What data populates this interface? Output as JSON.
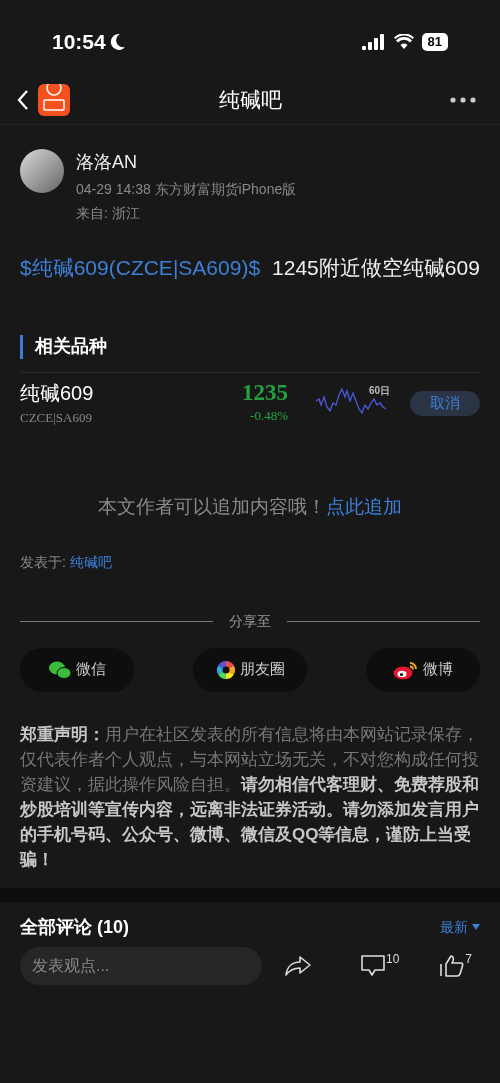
{
  "status_bar": {
    "time": "10:54",
    "battery": "81"
  },
  "nav": {
    "title": "纯碱吧"
  },
  "author": {
    "name": "洛洛AN",
    "meta": "04-29 14:38 东方财富期货iPhone版",
    "location": "来自: 浙江"
  },
  "post": {
    "tag": "$纯碱609(CZCE|SA609)$",
    "text": "1245附近做空纯碱609"
  },
  "related": {
    "heading": "相关品种",
    "items": [
      {
        "name": "纯碱609",
        "code": "CZCE|SA609",
        "price": "1235",
        "change": "-0.48%",
        "period": "60日",
        "action": "取消"
      }
    ]
  },
  "append": {
    "text": "本文作者可以追加内容哦！",
    "link": "点此追加"
  },
  "posted_in": {
    "label": "发表于:",
    "link": "纯碱吧"
  },
  "share": {
    "heading": "分享至",
    "buttons": [
      {
        "kind": "wechat",
        "label": "微信"
      },
      {
        "kind": "moments",
        "label": "朋友圈"
      },
      {
        "kind": "weibo",
        "label": "微博"
      }
    ]
  },
  "disclaimer": "**郑重声明：**用户在社区发表的所有信息将由本网站记录保存，仅代表作者个人观点，与本网站立场无关，不对您构成任何投资建议，据此操作风险自担。**请勿相信代客理财、免费荐股和炒股培训等宣传内容，远离非法证券活动。请勿添加发言用户的手机号码、公众号、微博、微信及QQ等信息，谨防上当受骗！**",
  "comments": {
    "heading": "全部评论 (10)",
    "sort": "最新"
  },
  "bottom_bar": {
    "placeholder": "发表观点...",
    "comment_count": "10",
    "like_count": "7"
  }
}
